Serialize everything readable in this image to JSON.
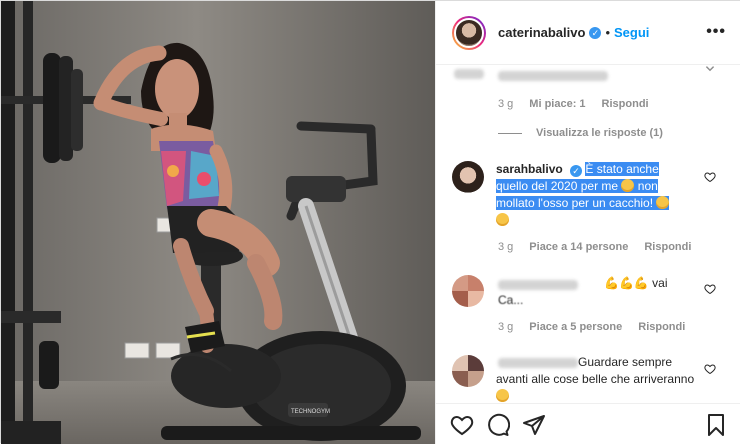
{
  "header": {
    "username": "caterinabalivo",
    "separator": "•",
    "follow_label": "Segui",
    "more_label": "•••"
  },
  "comments": [
    {
      "meta_time": "3 g",
      "meta_likes": "Mi piace: 1",
      "meta_reply": "Rispondi",
      "view_replies": "Visualizza le risposte (1)"
    },
    {
      "username": "sarahbalivo",
      "text_part1": "È stato anche quello del 2020 per me",
      "text_part2": "non mollato l'osso per un cacchio!",
      "meta_time": "3 g",
      "meta_likes": "Piace a 14 persone",
      "meta_reply": "Rispondi"
    },
    {
      "text_tail": "vai",
      "text_line2": "Ca...",
      "meta_time": "3 g",
      "meta_likes": "Piace a 5 persone",
      "meta_reply": "Rispondi"
    },
    {
      "text_part1": "Guardare sempre avanti alle cose belle che arriveranno"
    }
  ],
  "photo": {
    "brand_text": "TECHNOGYM"
  },
  "icons": [
    "heart-icon",
    "comment-icon",
    "share-icon",
    "bookmark-icon",
    "verified-icon",
    "more-icon"
  ],
  "colors": {
    "link": "#0095f6",
    "verified": "#3897f0",
    "highlight": "#3b8cf2",
    "meta": "#8e8e8e"
  }
}
